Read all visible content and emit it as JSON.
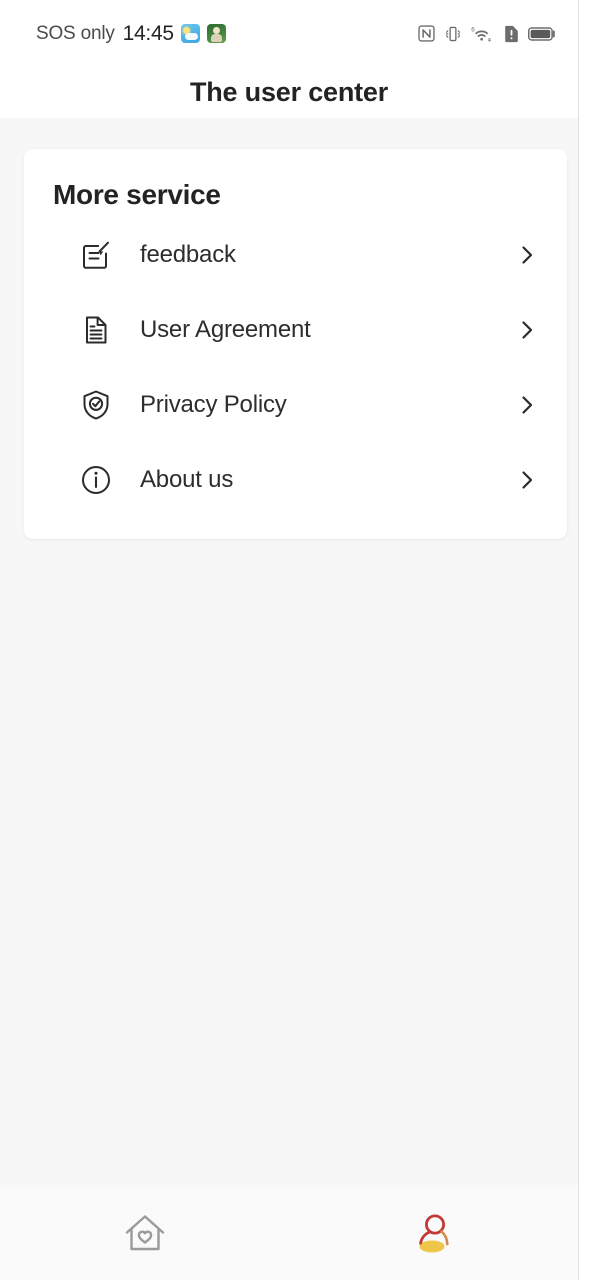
{
  "statusbar": {
    "carrier": "SOS only",
    "time": "14:45",
    "app_icons": [
      {
        "name": "weather-app-icon"
      },
      {
        "name": "game-app-icon"
      }
    ],
    "indicators": [
      {
        "name": "nfc-icon"
      },
      {
        "name": "vibrate-icon"
      },
      {
        "name": "wifi-6-icon"
      },
      {
        "name": "sim-alert-icon"
      },
      {
        "name": "battery-icon"
      }
    ]
  },
  "header": {
    "title": "The user center"
  },
  "card": {
    "title": "More service",
    "items": [
      {
        "label": "feedback",
        "icon": "feedback-icon",
        "chevron": "chevron-right-icon"
      },
      {
        "label": "User Agreement",
        "icon": "document-icon",
        "chevron": "chevron-right-icon"
      },
      {
        "label": "Privacy Policy",
        "icon": "shield-check-icon",
        "chevron": "chevron-right-icon"
      },
      {
        "label": "About us",
        "icon": "info-icon",
        "chevron": "chevron-right-icon"
      }
    ]
  },
  "bottom_nav": {
    "items": [
      {
        "name": "home",
        "icon": "home-heart-icon",
        "active": false
      },
      {
        "name": "profile",
        "icon": "user-icon",
        "active": true
      }
    ]
  },
  "colors": {
    "page_background": "#f7f7f7",
    "card_background": "#ffffff",
    "text_primary": "#232323",
    "text_label": "#2d2d2d",
    "icon_stroke": "#2b2b2b",
    "nav_inactive": "#9a9a9a",
    "nav_active_outline": "#c23a35",
    "nav_active_fill": "#f0c64a"
  }
}
